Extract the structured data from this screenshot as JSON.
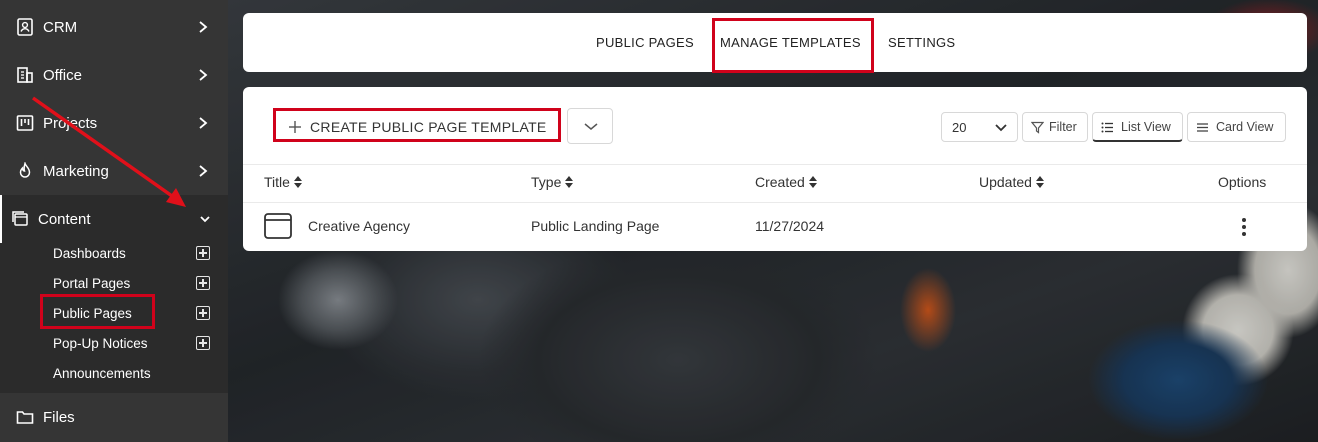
{
  "sidebar": {
    "items": [
      {
        "label": "CRM",
        "icon": "contact-book-icon"
      },
      {
        "label": "Office",
        "icon": "office-building-icon"
      },
      {
        "label": "Projects",
        "icon": "kanban-board-icon"
      },
      {
        "label": "Marketing",
        "icon": "flame-icon"
      },
      {
        "label": "Content",
        "icon": "stacked-windows-icon"
      }
    ],
    "content_sub": [
      {
        "label": "Dashboards"
      },
      {
        "label": "Portal Pages"
      },
      {
        "label": "Public Pages"
      },
      {
        "label": "Pop-Up Notices"
      },
      {
        "label": "Announcements"
      }
    ],
    "files": {
      "label": "Files",
      "icon": "folder-icon"
    }
  },
  "tabs": [
    {
      "label": "PUBLIC PAGES"
    },
    {
      "label": "MANAGE TEMPLATES"
    },
    {
      "label": "SETTINGS"
    }
  ],
  "toolbar": {
    "create_label": "CREATE PUBLIC PAGE TEMPLATE",
    "per_page": "20",
    "filter_label": "Filter",
    "list_view_label": "List View",
    "card_view_label": "Card View"
  },
  "table": {
    "headers": [
      "Title",
      "Type",
      "Created",
      "Updated",
      "Options"
    ],
    "rows": [
      {
        "title": "Creative Agency",
        "type": "Public Landing Page",
        "created": "11/27/2024",
        "updated": ""
      }
    ]
  },
  "colors": {
    "highlight": "#d0021b",
    "sidebar_bg": "#353535",
    "sidebar_active_bg": "#2b2b2b"
  }
}
